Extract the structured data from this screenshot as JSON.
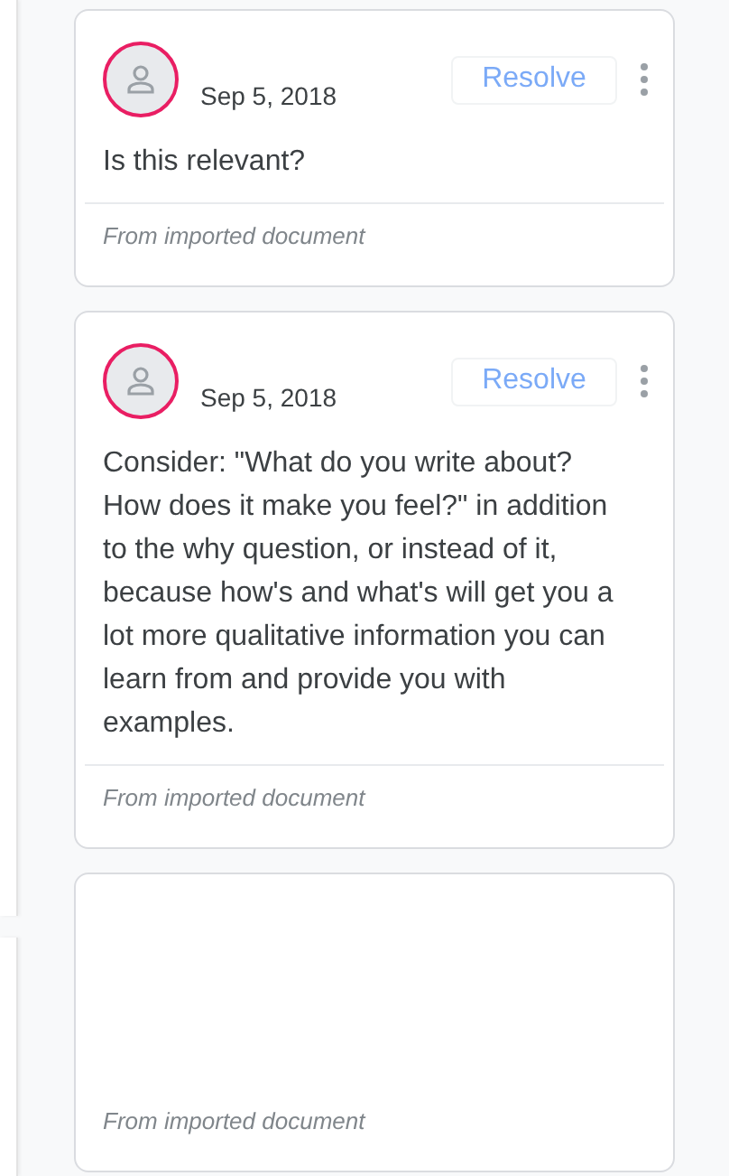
{
  "comments": [
    {
      "kind": "comment",
      "date": "Sep 5, 2018",
      "resolve": {
        "label": "Resolve",
        "disabled": true
      },
      "text": "Is this relevant?",
      "footer": "From imported document"
    },
    {
      "kind": "comment",
      "date": "Sep 5, 2018",
      "resolve": {
        "label": "Resolve",
        "disabled": true
      },
      "text": "Consider: \"What do you write about? How does it make you feel?\" in addition to the why question, or instead of it, because how's and what's will get you a lot more qualitative information you can learn from and provide you with examples.",
      "footer": "From imported document"
    },
    {
      "kind": "blank",
      "footer": "From imported document"
    }
  ]
}
